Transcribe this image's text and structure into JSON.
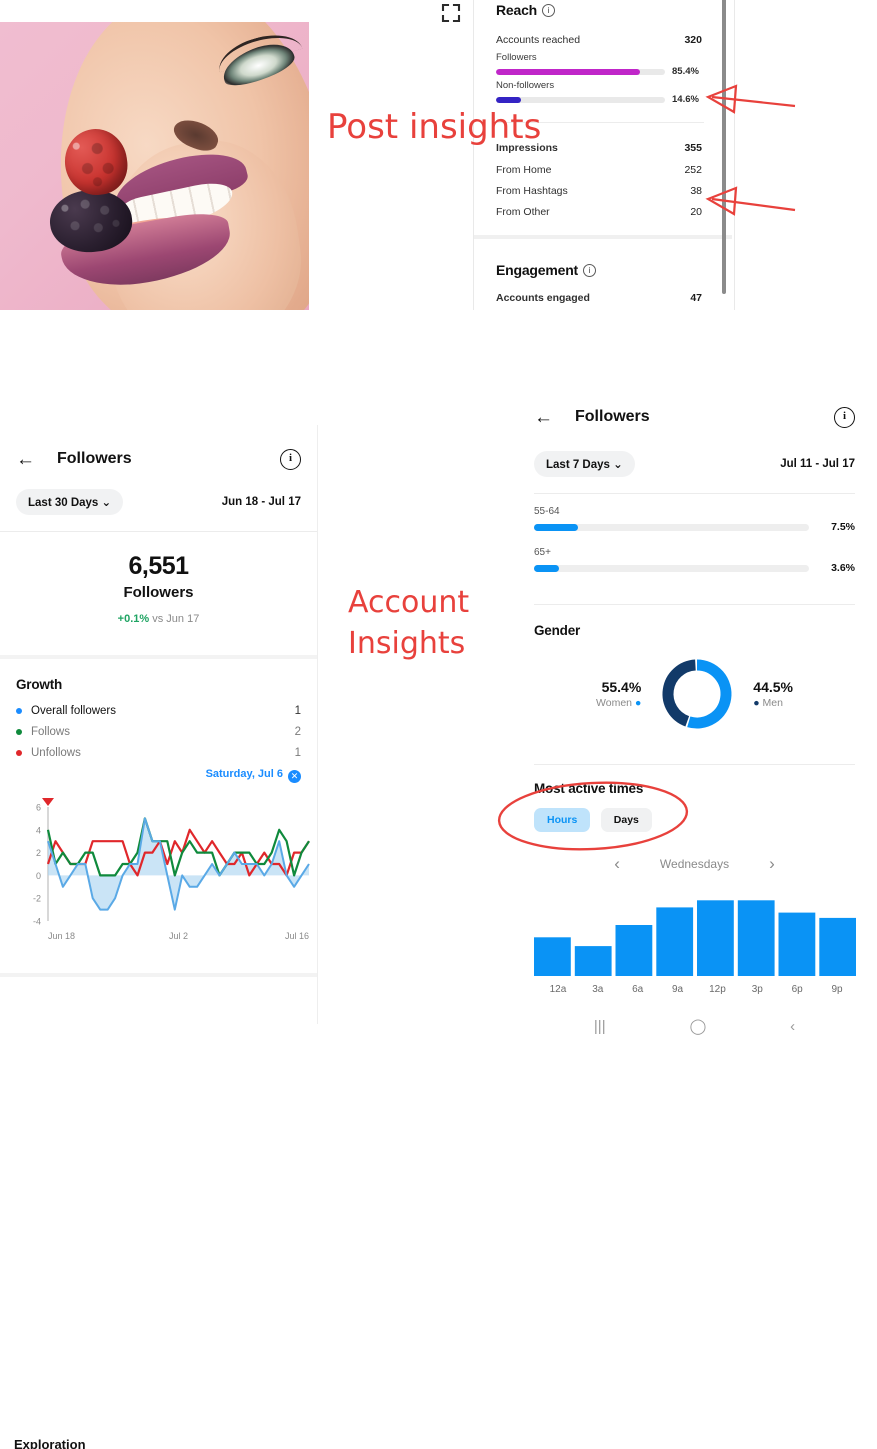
{
  "annotations": {
    "post_insights": "Post insights",
    "account_insights_line1": "Account",
    "account_insights_line2": "Insights",
    "color": "#e8413c"
  },
  "post_insights_card": {
    "expand_icon": "expand-icon",
    "reach": {
      "title": "Reach",
      "accounts_reached_label": "Accounts reached",
      "accounts_reached_value": "320",
      "bars": [
        {
          "label": "Followers",
          "pct": "85.4%",
          "value": 85.4,
          "color": "#c026c9"
        },
        {
          "label": "Non-followers",
          "pct": "14.6%",
          "value": 14.6,
          "color": "#3423c4"
        }
      ]
    },
    "impressions": {
      "label": "Impressions",
      "value": "355",
      "rows": [
        {
          "label": "From Home",
          "value": "252"
        },
        {
          "label": "From Hashtags",
          "value": "38"
        },
        {
          "label": "From Other",
          "value": "20"
        }
      ]
    },
    "engagement": {
      "title": "Engagement",
      "rows": [
        {
          "label": "Accounts engaged",
          "value": "47"
        }
      ]
    }
  },
  "followers_left": {
    "back_label": "←",
    "title": "Followers",
    "info_label": "i",
    "period_chip": "Last 30 Days",
    "date_range": "Jun 18 - Jul 17",
    "total_value": "6,551",
    "total_label": "Followers",
    "delta_value": "+0.1%",
    "delta_suffix": " vs Jun 17",
    "growth": {
      "title": "Growth",
      "rows": [
        {
          "label": "Overall followers",
          "value": "1",
          "color": "#1a8cff"
        },
        {
          "label": "Follows",
          "value": "2",
          "color": "#0f8a3c"
        },
        {
          "label": "Unfollows",
          "value": "1",
          "color": "#e0272b"
        }
      ],
      "selected_day": "Saturday, Jul 6",
      "clear_badge": "✕"
    },
    "bottom_section_cut": "Exploration"
  },
  "followers_right": {
    "back_label": "←",
    "title": "Followers",
    "info_label": "i",
    "period_chip": "Last 7 Days",
    "date_range": "Jul 11 - Jul 17",
    "age_rows": [
      {
        "label": "55-64",
        "pct": "7.5%",
        "value": 7.5
      },
      {
        "label": "65+",
        "pct": "3.6%",
        "value": 3.6
      }
    ],
    "gender": {
      "title": "Gender",
      "women_pct": "55.4%",
      "women_label": "Women",
      "women_color": "#0a93f5",
      "men_pct": "44.5%",
      "men_label": "Men",
      "men_color": "#123a69"
    },
    "most_active": {
      "title": "Most active times",
      "toggle_hours": "Hours",
      "toggle_days": "Days",
      "toggle_selected": "Hours",
      "prev_label": "‹",
      "day_label": "Wednesdays",
      "next_label": "›"
    }
  },
  "chart_data": [
    {
      "type": "line",
      "title": "Growth",
      "xlabel": "",
      "ylabel": "",
      "ylim": [
        -4,
        6
      ],
      "yticks": [
        6,
        4,
        2,
        0,
        -2,
        -4
      ],
      "xticks": [
        "Jun 18",
        "Jul 2",
        "Jul 16"
      ],
      "grid": false,
      "legend_position": "above-chart",
      "series": [
        {
          "name": "Overall followers",
          "color": "#5aa9e6",
          "area": true,
          "values": [
            3,
            1,
            -1,
            0,
            1,
            1,
            -2,
            -3,
            -3,
            -2,
            0,
            1,
            1,
            5,
            3,
            3,
            0,
            -3,
            0,
            -1,
            -1,
            0,
            1,
            0,
            1,
            2,
            1,
            1,
            1,
            0,
            1,
            3,
            0,
            -1,
            0,
            1
          ]
        },
        {
          "name": "Follows",
          "color": "#0f8a3c",
          "values": [
            4,
            1,
            2,
            1,
            1,
            2,
            2,
            0,
            0,
            0,
            1,
            1,
            2,
            5,
            3,
            3,
            3,
            0,
            2,
            3,
            2,
            2,
            2,
            0,
            1,
            2,
            2,
            2,
            1,
            1,
            2,
            4,
            3,
            0,
            2,
            3
          ]
        },
        {
          "name": "Unfollows",
          "color": "#e0272b",
          "values": [
            1,
            3,
            2,
            1,
            1,
            1,
            3,
            3,
            3,
            3,
            3,
            1,
            0,
            2,
            2,
            3,
            1,
            3,
            2,
            4,
            3,
            2,
            3,
            2,
            1,
            1,
            2,
            0,
            1,
            2,
            1,
            1,
            0,
            2,
            2,
            3
          ]
        }
      ]
    },
    {
      "type": "donut",
      "title": "Gender",
      "labels": [
        "Women",
        "Men"
      ],
      "values": [
        55.4,
        44.5
      ],
      "colors": [
        "#0a93f5",
        "#123a69"
      ]
    },
    {
      "type": "bar",
      "title": "Most active times",
      "subtitle": "Wednesdays",
      "categories": [
        "12a",
        "3a",
        "6a",
        "9a",
        "12p",
        "3p",
        "6p",
        "9p"
      ],
      "values": [
        44,
        34,
        58,
        78,
        86,
        86,
        72,
        66
      ],
      "ylim": [
        0,
        100
      ],
      "grid": false,
      "color": "#0a93f5"
    },
    {
      "type": "bar",
      "title": "Reach",
      "categories": [
        "Followers",
        "Non-followers"
      ],
      "values": [
        85.4,
        14.6
      ],
      "ylim": [
        0,
        100
      ],
      "colors": [
        "#c026c9",
        "#3423c4"
      ],
      "orientation": "horizontal"
    },
    {
      "type": "bar",
      "title": "Followers by age",
      "categories": [
        "55-64",
        "65+"
      ],
      "values": [
        7.5,
        3.6
      ],
      "ylim": [
        0,
        100
      ],
      "color": "#0a93f5",
      "orientation": "horizontal"
    }
  ],
  "android_nav": {
    "recents": "|||",
    "home": "◯",
    "back": "‹"
  }
}
